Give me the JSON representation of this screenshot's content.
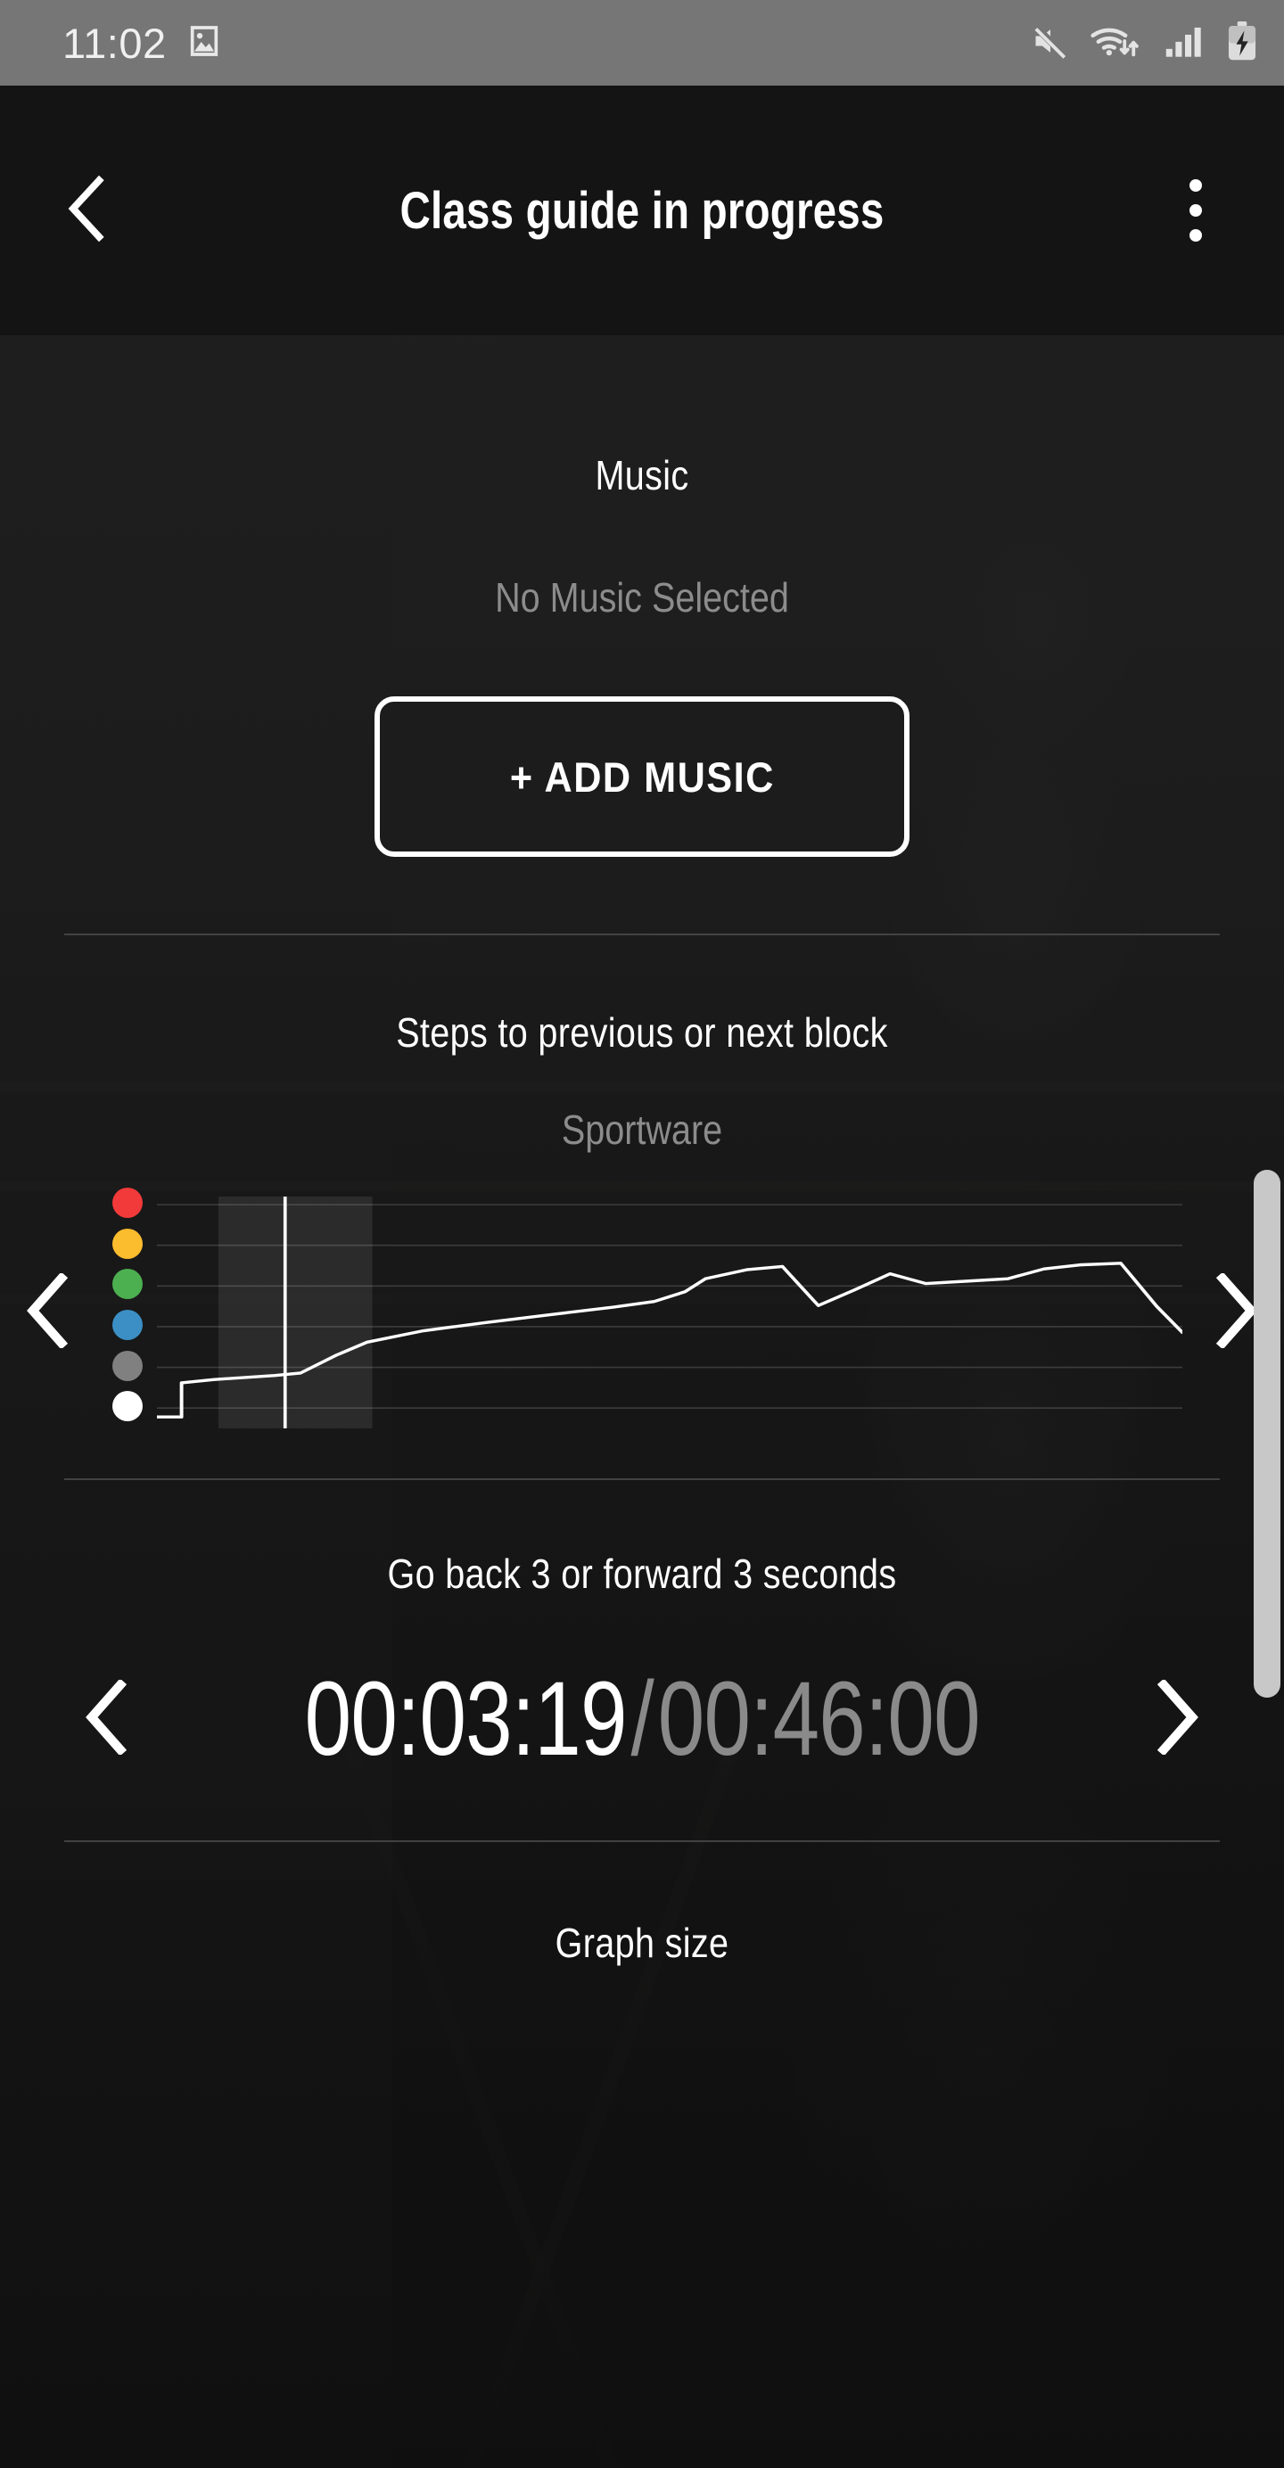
{
  "status_bar": {
    "time": "11:02",
    "left_icons": [
      "image-icon"
    ],
    "right_icons": [
      "mute-icon",
      "wifi-icon",
      "cellular-signal-icon",
      "battery-charging-icon"
    ]
  },
  "app_bar": {
    "title": "Class guide in progress",
    "back_icon": "chevron-left-icon",
    "overflow_icon": "more-vertical-icon"
  },
  "music": {
    "title": "Music",
    "status": "No Music Selected",
    "add_button_label": "+ ADD MUSIC"
  },
  "steps": {
    "title": "Steps to previous or next block",
    "subtitle": "Sportware",
    "prev_icon": "chevron-left-icon",
    "next_icon": "chevron-right-icon"
  },
  "seek": {
    "title": "Go back 3 or forward 3 seconds",
    "prev_icon": "chevron-left-icon",
    "next_icon": "chevron-right-icon",
    "elapsed": "00:03:19",
    "separator": "/",
    "total": "00:46:00"
  },
  "graph_size": {
    "title": "Graph size"
  },
  "colors": {
    "status_bar_bg": "#767676",
    "app_bar_bg": "#141414",
    "page_bg": "#1f1f1f",
    "primary_text": "#ffffff",
    "muted_text": "#8c8c8c",
    "divider": "#4a4a4a",
    "line": "#ffffff",
    "scrollbar": "#c8c8c8"
  },
  "chart_data": {
    "type": "line",
    "title": "Sportware",
    "xlabel": "",
    "ylabel": "",
    "grid": true,
    "legend": "left-zone-dots",
    "zones": [
      {
        "name": "zone-6-red",
        "color": "#F23A3A",
        "y": 6
      },
      {
        "name": "zone-5-yellow",
        "color": "#FBBC2E",
        "y": 5
      },
      {
        "name": "zone-4-green",
        "color": "#4CAF50",
        "y": 4
      },
      {
        "name": "zone-3-blue",
        "color": "#3B8FC4",
        "y": 3
      },
      {
        "name": "zone-2-gray",
        "color": "#808080",
        "y": 2
      },
      {
        "name": "zone-1-white",
        "color": "#FFFFFF",
        "y": 1
      }
    ],
    "ylim": [
      0.5,
      6.2
    ],
    "xlim": [
      0,
      100
    ],
    "playhead_x": 12.5,
    "highlight_block": {
      "x_start": 6.0,
      "x_end": 21.0
    },
    "series": [
      {
        "name": "intensity",
        "x": [
          0.0,
          2.4,
          2.4,
          5.5,
          11.5,
          14.0,
          17.5,
          20.5,
          26.0,
          32.0,
          38.5,
          44.5,
          48.5,
          51.5,
          53.5,
          57.5,
          61.0,
          64.5,
          68.0,
          71.5,
          75.0,
          79.0,
          83.0,
          86.5,
          90.0,
          94.0,
          97.5,
          100.0
        ],
        "y": [
          0.78,
          0.78,
          1.62,
          1.7,
          1.8,
          1.86,
          2.3,
          2.62,
          2.9,
          3.1,
          3.3,
          3.48,
          3.62,
          3.86,
          4.18,
          4.4,
          4.48,
          3.52,
          3.9,
          4.3,
          4.06,
          4.12,
          4.18,
          4.42,
          4.52,
          4.56,
          3.5,
          2.86
        ]
      }
    ]
  }
}
